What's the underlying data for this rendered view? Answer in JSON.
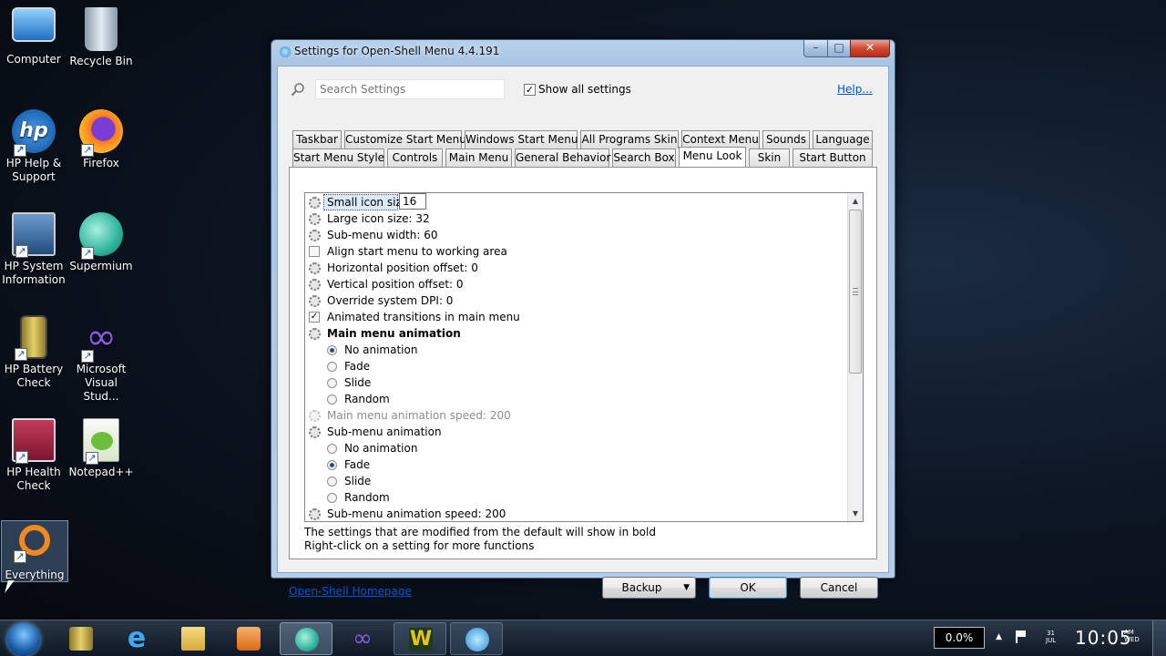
{
  "desktop": {
    "icons": [
      {
        "label": "Computer",
        "icon": "computer-icon"
      },
      {
        "label": "Recycle Bin",
        "icon": "recycle-bin-icon"
      },
      {
        "label": "HP Help & Support",
        "icon": "hp-logo-icon"
      },
      {
        "label": "Firefox",
        "icon": "firefox-icon"
      },
      {
        "label": "HP System Information",
        "icon": "system-info-icon"
      },
      {
        "label": "Supermium",
        "icon": "supermium-icon"
      },
      {
        "label": "HP Battery Check",
        "icon": "battery-icon"
      },
      {
        "label": "Microsoft Visual Stud...",
        "icon": "visual-studio-icon"
      },
      {
        "label": "HP Health Check",
        "icon": "health-check-icon"
      },
      {
        "label": "Notepad++",
        "icon": "notepad-plus-plus-icon"
      },
      {
        "label": "Everything",
        "icon": "everything-search-icon"
      }
    ]
  },
  "window": {
    "title": "Settings for Open-Shell Menu 4.4.191",
    "search_placeholder": "Search Settings",
    "show_all_label": "Show all settings",
    "show_all_checked": true,
    "help_link": "Help...",
    "tabs_row1": [
      "Taskbar",
      "Customize Start Menu",
      "Windows Start Menu",
      "All Programs Skin",
      "Context Menu",
      "Sounds",
      "Language"
    ],
    "tabs_row2": [
      "Start Menu Style",
      "Controls",
      "Main Menu",
      "General Behavior",
      "Search Box",
      "Menu Look",
      "Skin",
      "Start Button"
    ],
    "active_tab": "Menu Look",
    "settings": {
      "small_icon_size_label": "Small icon size",
      "small_icon_size_value": "16",
      "large_icon_size": "Large icon size: 32",
      "submenu_width": "Sub-menu width: 60",
      "align_start_menu": "Align start menu to working area",
      "horizontal_offset": "Horizontal position offset: 0",
      "vertical_offset": "Vertical position offset: 0",
      "override_dpi": "Override system DPI: 0",
      "animated_transitions": "Animated transitions in main menu",
      "main_menu_animation": "Main menu animation",
      "main_opt_none": "No animation",
      "main_opt_fade": "Fade",
      "main_opt_slide": "Slide",
      "main_opt_random": "Random",
      "main_animation_speed": "Main menu animation speed: 200",
      "submenu_animation": "Sub-menu animation",
      "sub_opt_none": "No animation",
      "sub_opt_fade": "Fade",
      "sub_opt_slide": "Slide",
      "sub_opt_random": "Random",
      "submenu_animation_speed": "Sub-menu animation speed: 200"
    },
    "note_line1": "The settings that are modified from the default will show in bold",
    "note_line2": "Right-click on a setting for more functions",
    "homepage_link": "Open-Shell Homepage",
    "backup_label": "Backup",
    "ok_label": "OK",
    "cancel_label": "Cancel"
  },
  "taskbar": {
    "cpu_usage": "0.0%",
    "time": "10:05",
    "ampm": "AM",
    "day": "WED",
    "date_day": "31",
    "date_month": "JUL"
  }
}
